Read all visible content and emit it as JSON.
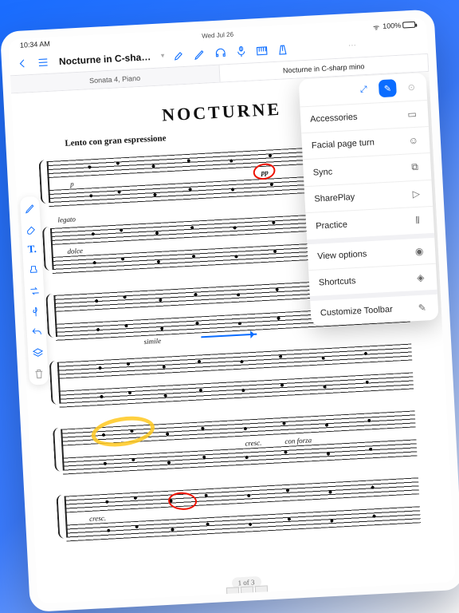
{
  "status": {
    "time": "10:34 AM",
    "date": "Wed Jul 26",
    "battery": "100%"
  },
  "toolbar": {
    "title": "Nocturne in C-sharp m…"
  },
  "tabs": [
    {
      "label": "Sonata 4, Piano",
      "active": false
    },
    {
      "label": "Nocturne in C-sharp mino",
      "active": true
    }
  ],
  "sheet": {
    "title": "NOCTURNE",
    "tempo": "Lento con gran espressione",
    "dynamics": {
      "p": "p",
      "pp": "pp"
    },
    "expr": {
      "legato": "legato",
      "dolce": "dolce",
      "simile": "simile",
      "cresc": "cresc.",
      "conforza": "con forza",
      "cresc2": "cresc."
    },
    "pager": "1 of 3"
  },
  "menu": {
    "items": [
      {
        "label": "Accessories",
        "icon": "▭"
      },
      {
        "label": "Facial page turn",
        "icon": "☺"
      },
      {
        "label": "Sync",
        "icon": "⧉"
      },
      {
        "label": "SharePlay",
        "icon": "▷"
      },
      {
        "label": "Practice",
        "icon": "⫴"
      },
      {
        "label": "View options",
        "icon": "◉",
        "sep": true
      },
      {
        "label": "Shortcuts",
        "icon": "◈"
      },
      {
        "label": "Customize Toolbar",
        "icon": "✎",
        "sep": true
      }
    ]
  }
}
